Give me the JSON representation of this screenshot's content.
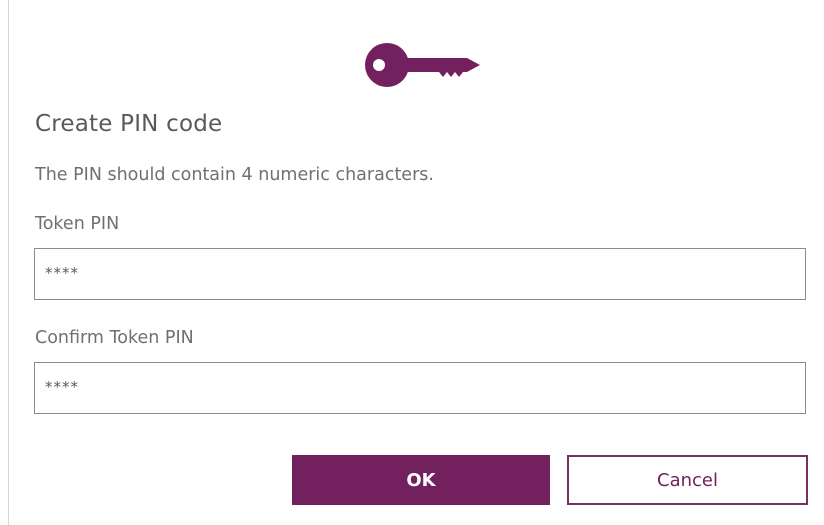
{
  "dialog": {
    "title": "Create PIN code",
    "description": "The PIN should contain 4 numeric characters.",
    "icon": "key-icon",
    "accent_color": "#73215e"
  },
  "fields": {
    "pin": {
      "label": "Token PIN",
      "value": "****"
    },
    "confirm": {
      "label": "Confirm Token PIN",
      "value": "****"
    }
  },
  "buttons": {
    "ok_label": "OK",
    "cancel_label": "Cancel"
  }
}
